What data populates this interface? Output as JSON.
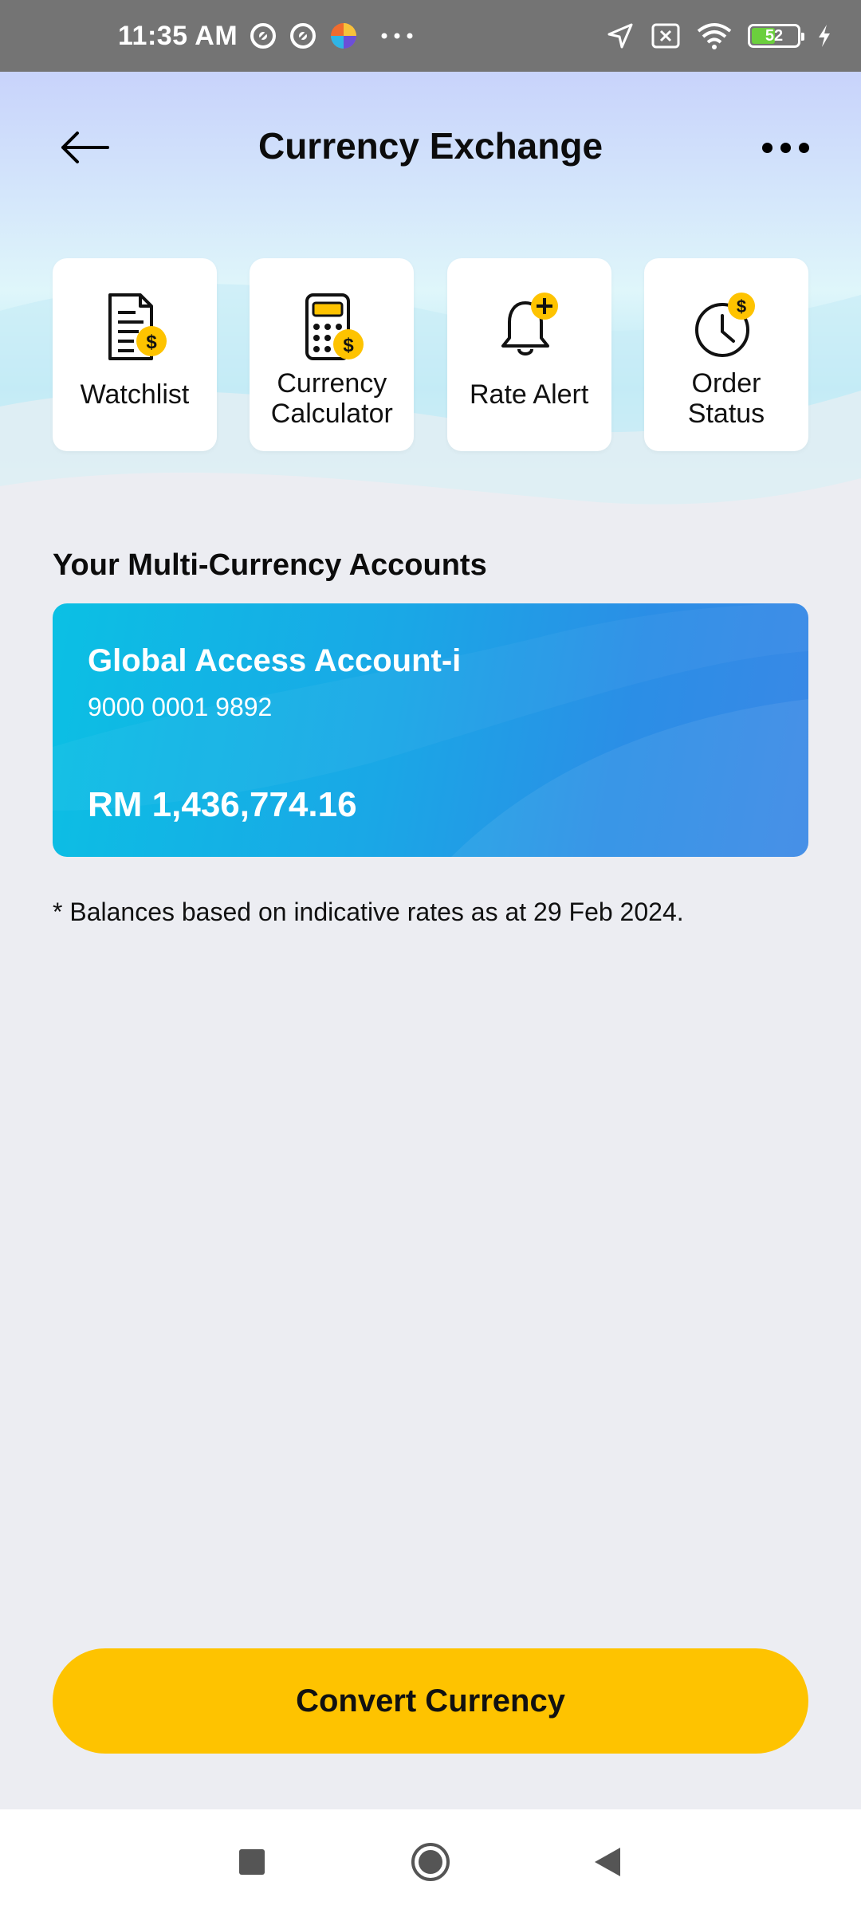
{
  "status_bar": {
    "time": "11:35 AM",
    "battery_level": "52",
    "icons_left": [
      "sync-circle-icon",
      "sync-circle-icon",
      "app-bubble-icon",
      "more-dots-icon"
    ],
    "icons_right": [
      "location-arrow-icon",
      "sim-off-icon",
      "wifi-icon",
      "battery-icon",
      "charging-bolt-icon"
    ]
  },
  "header": {
    "title": "Currency Exchange",
    "back_icon": "arrow-left-icon",
    "more_icon": "more-horizontal-icon"
  },
  "quick_actions": [
    {
      "label": "Watchlist",
      "icon": "document-dollar-icon"
    },
    {
      "label": "Currency Calculator",
      "icon": "calculator-dollar-icon"
    },
    {
      "label": "Rate Alert",
      "icon": "bell-plus-icon"
    },
    {
      "label": "Order Status",
      "icon": "clock-dollar-icon"
    }
  ],
  "section": {
    "title": "Your Multi-Currency Accounts"
  },
  "account": {
    "name": "Global Access Account-i",
    "number": "9000 0001 9892",
    "balance": "RM 1,436,774.16"
  },
  "disclaimer": "* Balances based on indicative rates as at 29 Feb 2024.",
  "convert_button": {
    "label": "Convert Currency"
  },
  "colors": {
    "accent_yellow": "#fec300",
    "card_start": "#0bc0e4",
    "card_end": "#3a88e6",
    "background": "#ecedf2"
  },
  "nav": {
    "icons": [
      "recents-square-icon",
      "home-circle-icon",
      "back-triangle-icon"
    ]
  }
}
